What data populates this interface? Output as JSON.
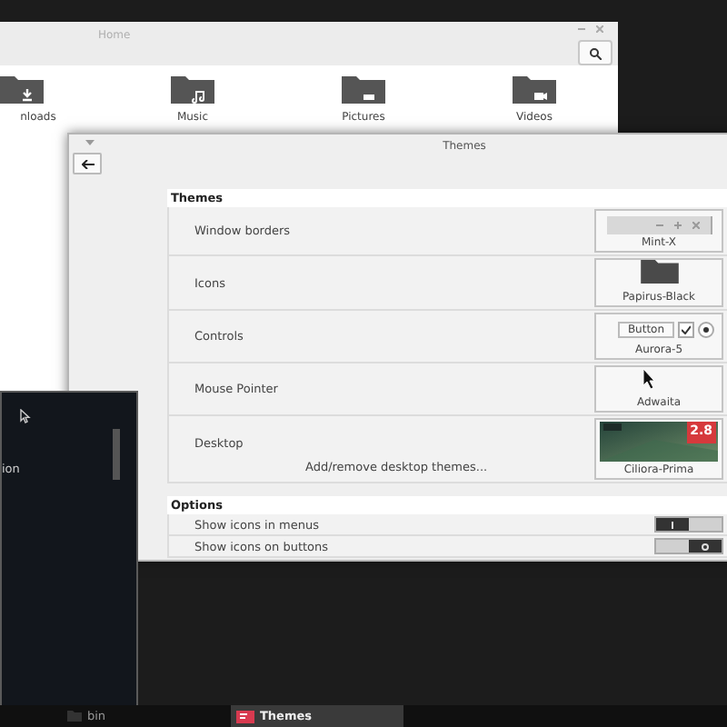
{
  "home_window": {
    "title": "Home",
    "places": [
      {
        "label": "nloads",
        "kind": "downloads"
      },
      {
        "label": "Music",
        "kind": "music"
      },
      {
        "label": "Pictures",
        "kind": "pictures"
      },
      {
        "label": "Videos",
        "kind": "videos"
      }
    ]
  },
  "themes_window": {
    "title": "Themes",
    "themes_section": {
      "title": "Themes",
      "rows": [
        {
          "label": "Window borders",
          "kind": "window-borders",
          "preview_label": "Mint-X"
        },
        {
          "label": "Icons",
          "kind": "icons",
          "preview_label": "Papirus-Black"
        },
        {
          "label": "Controls",
          "kind": "controls",
          "preview_label": "Aurora-5",
          "sample_button": "Button",
          "sample_checked": true,
          "sample_radio_selected": true
        },
        {
          "label": "Mouse Pointer",
          "kind": "pointer",
          "preview_label": "Adwaita"
        },
        {
          "label": "Desktop",
          "kind": "desktop",
          "preview_label": "Ciliora-Prima",
          "link": "Add/remove desktop themes...",
          "badge": "2.8"
        }
      ]
    },
    "options_section": {
      "title": "Options",
      "rows": [
        {
          "label": "Show icons in menus",
          "on": true
        },
        {
          "label": "Show icons on buttons",
          "on": false
        }
      ]
    }
  },
  "terminal": {
    "text": "ion"
  },
  "taskbar": {
    "items": [
      {
        "label": "bin",
        "selected": false
      },
      {
        "label": "Themes",
        "selected": true
      }
    ]
  }
}
